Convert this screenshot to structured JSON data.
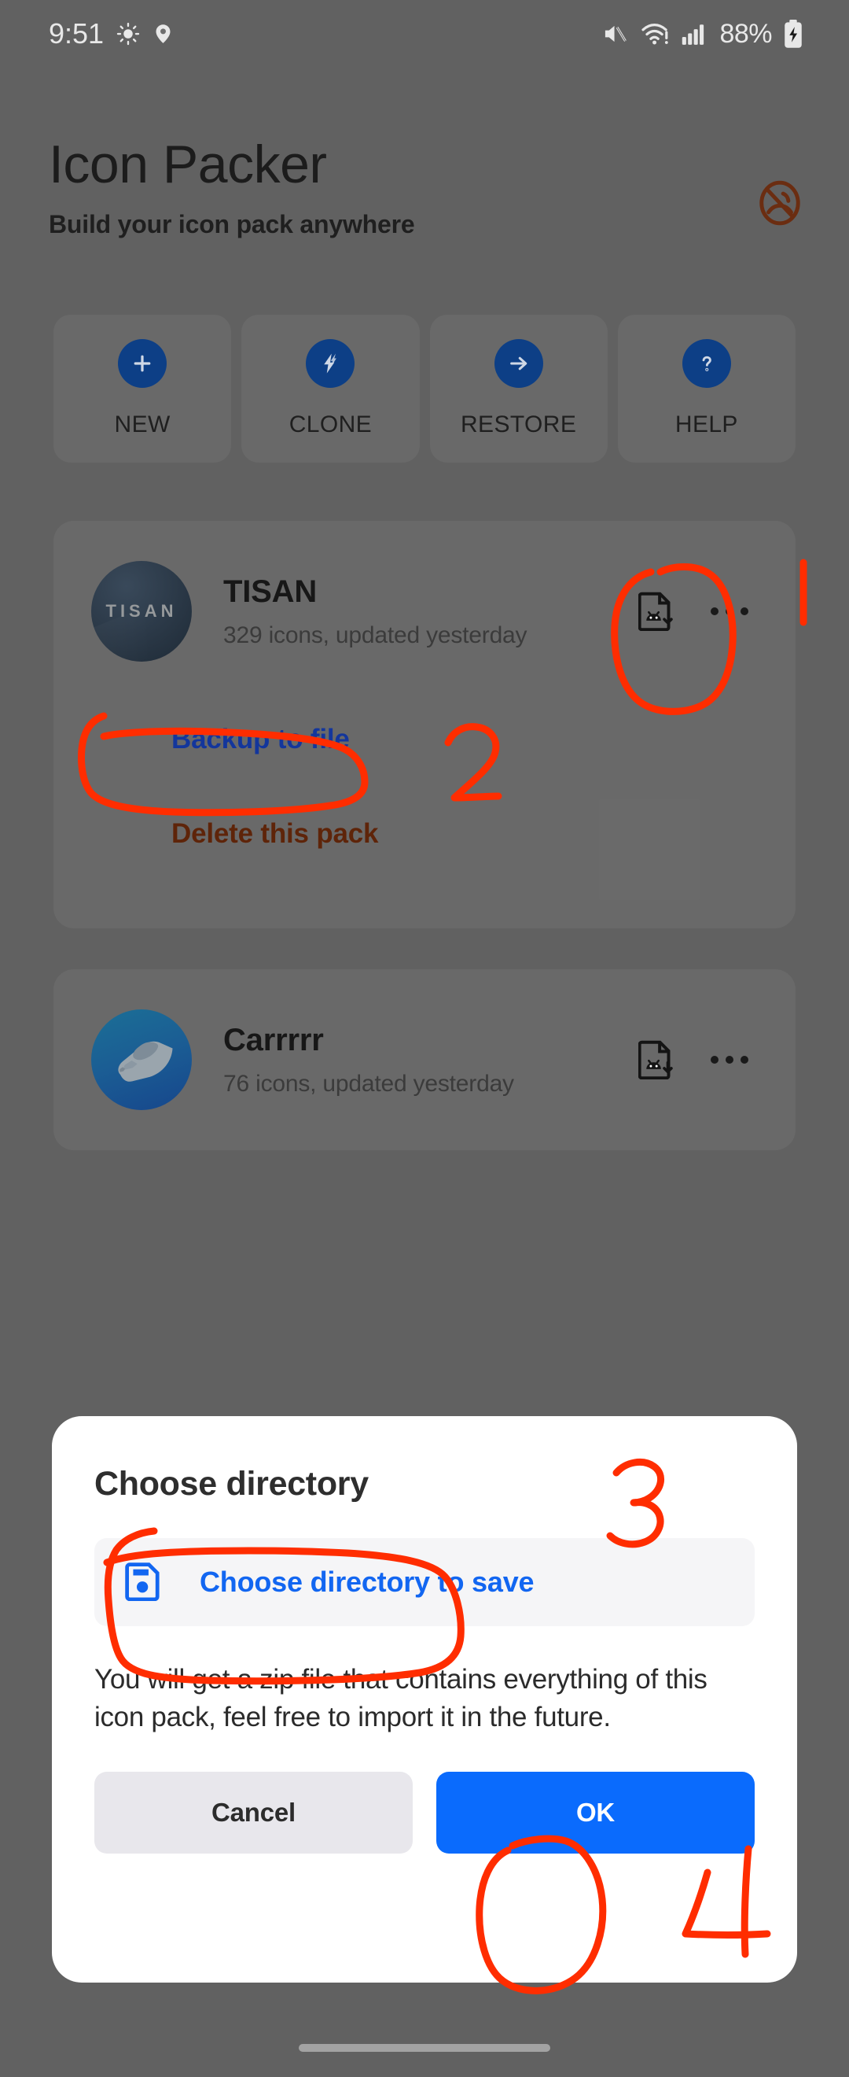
{
  "status_bar": {
    "time": "9:51",
    "left_icons": [
      "brightness-icon",
      "location-icon"
    ],
    "right_icons": [
      "mute-icon",
      "wifi-warning-icon",
      "signal-icon"
    ],
    "battery_text": "88%",
    "battery_icon": "battery-charging-icon"
  },
  "header": {
    "title": "Icon Packer",
    "subtitle": "Build your icon pack anywhere",
    "no_ads_icon": "no-ads-icon",
    "no_ads_color": "#6b2d11"
  },
  "actions": [
    {
      "label": "NEW",
      "icon": "plus-icon"
    },
    {
      "label": "CLONE",
      "icon": "lightning-icon"
    },
    {
      "label": "RESTORE",
      "icon": "arrow-right-icon"
    },
    {
      "label": "HELP",
      "icon": "question-mark-icon"
    }
  ],
  "packs": [
    {
      "name": "TISAN",
      "meta": "329 icons, updated yesterday",
      "logo_text": "TISAN",
      "logo_type": "tisan-logo",
      "apk_icon": "apk-file-icon",
      "overflow_icon": "more-options-icon",
      "expanded": true,
      "menu": {
        "backup": "Backup to file",
        "delete": "Delete this pack"
      }
    },
    {
      "name": "Carrrrr",
      "meta": "76 icons, updated yesterday",
      "logo_text": "",
      "logo_type": "train-logo",
      "apk_icon": "apk-file-download-icon",
      "overflow_icon": "more-options-icon",
      "expanded": false
    }
  ],
  "dialog": {
    "title": "Choose directory",
    "choose_icon": "save-floppy-icon",
    "choose_label": "Choose directory to save",
    "body": "You will get a zip file that contains everything of this icon pack, feel free to import it in the future.",
    "cancel_label": "Cancel",
    "ok_label": "OK",
    "ok_color": "#0a6bfd"
  },
  "annotations": {
    "color": "#ff2d00",
    "steps": [
      "1",
      "2",
      "3",
      "4"
    ]
  },
  "nav_bar": {
    "pill": "home-gesture-pill"
  }
}
